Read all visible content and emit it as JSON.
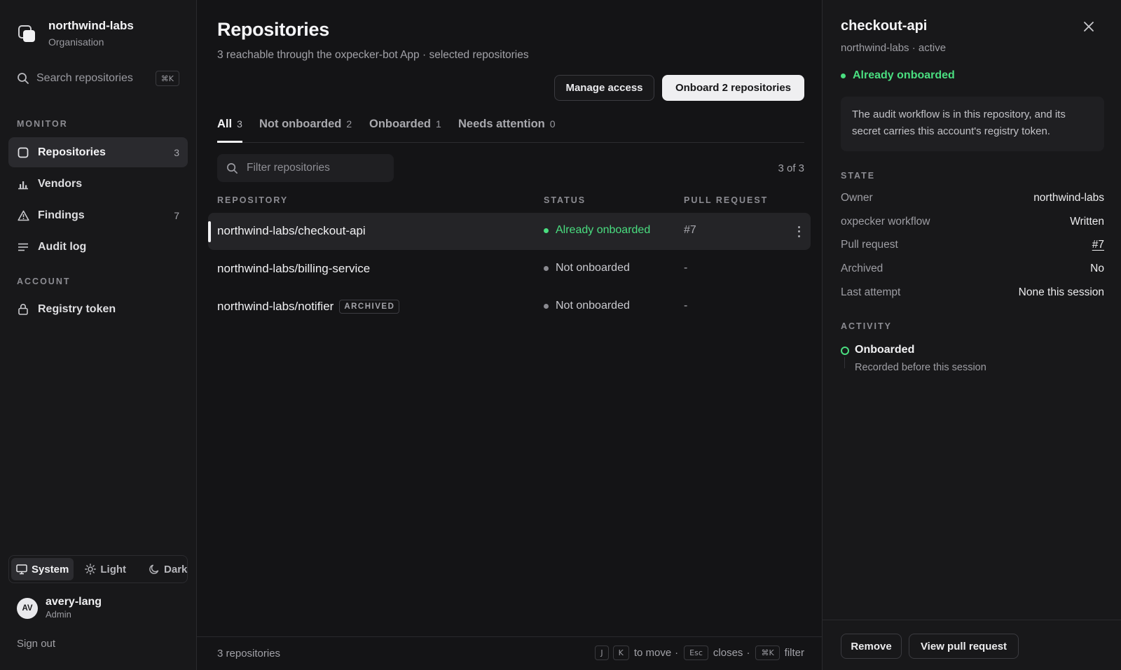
{
  "org": {
    "name": "northwind-labs",
    "role": "Organisation"
  },
  "sidebar": {
    "search": {
      "placeholder": "Search repositories",
      "shortcut": "⌘K"
    },
    "sections": {
      "monitor": "MONITOR",
      "account": "ACCOUNT"
    },
    "items": [
      {
        "label": "Repositories",
        "count": "3",
        "icon": "repo-icon",
        "active": true
      },
      {
        "label": "Vendors",
        "count": "",
        "icon": "bar-chart-icon"
      },
      {
        "label": "Findings",
        "count": "7",
        "icon": "warning-icon"
      },
      {
        "label": "Audit log",
        "count": "",
        "icon": "list-icon"
      }
    ],
    "account_items": [
      {
        "label": "Registry token",
        "icon": "lock-icon"
      }
    ],
    "theme": {
      "system": "System",
      "light": "Light",
      "dark": "Dark",
      "selected": "System"
    },
    "user": {
      "initials": "AV",
      "name": "avery-lang",
      "role": "Admin"
    },
    "signout": "Sign out"
  },
  "main": {
    "title": "Repositories",
    "subtitle": "3 reachable through the oxpecker-bot App · selected repositories",
    "actions": {
      "manage": "Manage access",
      "onboard": "Onboard 2 repositories"
    },
    "tabs": [
      {
        "label": "All",
        "count": "3",
        "active": true
      },
      {
        "label": "Not onboarded",
        "count": "2"
      },
      {
        "label": "Onboarded",
        "count": "1"
      },
      {
        "label": "Needs attention",
        "count": "0"
      }
    ],
    "filter": {
      "placeholder": "Filter repositories",
      "value": ""
    },
    "count_label": "3 of 3",
    "columns": {
      "repository": "REPOSITORY",
      "status": "STATUS",
      "pull_request": "PULL REQUEST"
    },
    "rows": [
      {
        "repo": "northwind-labs/checkout-api",
        "badge": "",
        "status": "Already onboarded",
        "pr": "#7",
        "selected": true
      },
      {
        "repo": "northwind-labs/billing-service",
        "badge": "",
        "status": "Not onboarded",
        "pr": "-"
      },
      {
        "repo": "northwind-labs/notifier",
        "badge": "ARCHIVED",
        "status": "Not onboarded",
        "pr": "-"
      }
    ],
    "footer": {
      "left": "3 repositories",
      "key_j": "J",
      "key_k": "K",
      "to_move": "to move",
      "key_esc": "Esc",
      "closes": "closes",
      "key_cmdk": "⌘K",
      "filter": "filter",
      "separator": "·"
    }
  },
  "panel": {
    "title": "checkout-api",
    "subtitle": "northwind-labs · active",
    "status": "Already onboarded",
    "note": "The audit workflow is in this repository, and its secret carries this account's registry token.",
    "state_label": "STATE",
    "state": [
      {
        "key": "Owner",
        "value": "northwind-labs"
      },
      {
        "key": "oxpecker workflow",
        "value": "Written"
      },
      {
        "key": "Pull request",
        "value": "#7",
        "link": true
      },
      {
        "key": "Archived",
        "value": "No"
      },
      {
        "key": "Last attempt",
        "value": "None this session"
      }
    ],
    "activity_label": "ACTIVITY",
    "activity": {
      "title": "Onboarded",
      "desc": "Recorded before this session"
    },
    "buttons": {
      "remove": "Remove",
      "view_pr": "View pull request"
    }
  },
  "colors": {
    "accent_green": "#4ade80",
    "background": "#141416",
    "sidebar": "#18181a"
  }
}
